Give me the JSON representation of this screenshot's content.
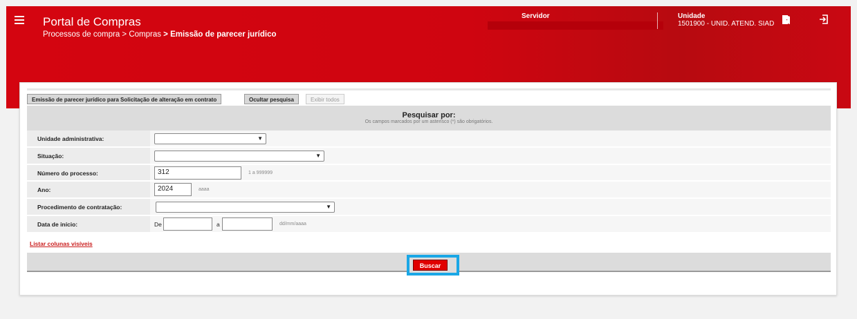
{
  "header": {
    "app_title": "Portal de Compras",
    "breadcrumb": {
      "part1": "Processos de compra",
      "sep": " > ",
      "part2": "Compras",
      "current": "Emissão de parecer jurídico"
    },
    "servidor_label": "Servidor",
    "unidade_label": "Unidade",
    "unidade_value": "1501900 - UNID. ATEND. SIAD",
    "icons": [
      "menu-icon",
      "door-icon",
      "exit-icon"
    ]
  },
  "toolbar": {
    "btn_emissao": "Emissão de parecer jurídico para Solicitação de alteração em contrato",
    "btn_ocultar": "Ocultar pesquisa",
    "btn_exibir": "Exibir todos"
  },
  "search": {
    "title": "Pesquisar por:",
    "subtitle": "Os campos marcados por um asterisco (*) são obrigatórios."
  },
  "fields": {
    "unidade_admin": {
      "label": "Unidade administrativa:",
      "value": ""
    },
    "situacao": {
      "label": "Situação:",
      "value": ""
    },
    "numero": {
      "label": "Número do processo:",
      "value": "312",
      "hint": "1 a 999999"
    },
    "ano": {
      "label": "Ano:",
      "value": "2024",
      "hint": "aaaa"
    },
    "procedimento": {
      "label": "Procedimento de contratação:",
      "value": ""
    },
    "data_inicio": {
      "label": "Data de início:",
      "de": "De",
      "a": "a",
      "hint": "dd/mm/aaaa"
    }
  },
  "list_columns_link": "Listar colunas visíveis",
  "buscar_label": "Buscar",
  "colors": {
    "header_red": "#d40510",
    "button_red": "#e00000",
    "highlight": "#1aa7e6"
  }
}
